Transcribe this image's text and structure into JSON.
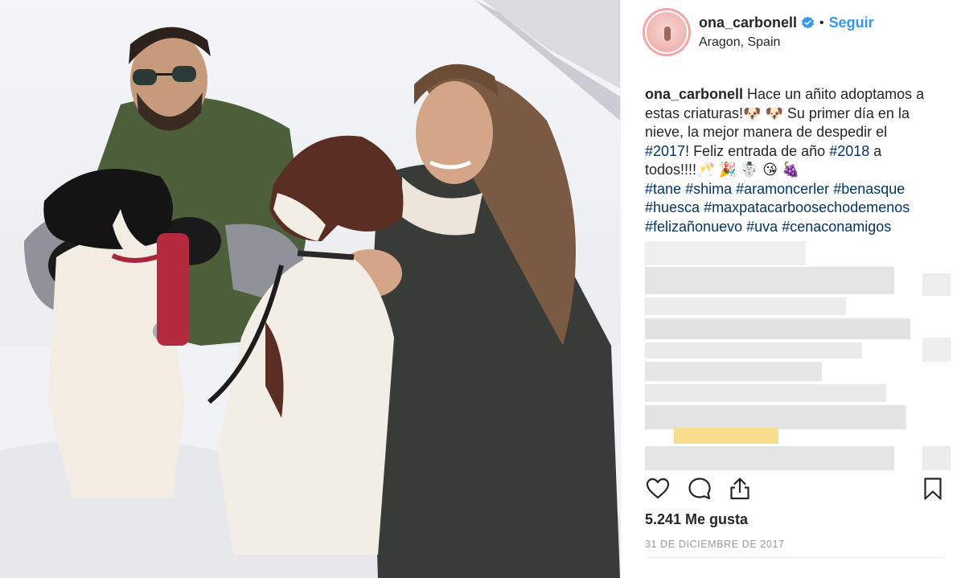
{
  "post": {
    "username": "ona_carbonell",
    "location": "Aragon, Spain",
    "follow_label": "Seguir",
    "separator": "•",
    "caption": {
      "user": "ona_carbonell",
      "line1": "Hace un añito adoptamos a",
      "line2": "estas criaturas!🐶 🐶  Su primer día en la",
      "line3": "nieve, la mejor manera de despedir el",
      "tag_2017": "#2017",
      "line4_mid": "! Feliz entrada de año ",
      "tag_2018": "#2018",
      "line4_end": " a",
      "line5": "todos!!!!🥂 🎉 ☃️ 😘 🍇",
      "tags_row1": [
        "#tane",
        "#shima",
        "#aramoncerler",
        "#benasque"
      ],
      "tags_row2": [
        "#huesca",
        "#maxpatacarboosechodemenos"
      ],
      "tags_row3": [
        "#felizañonuevo",
        "#uva",
        "#cenaconamigos"
      ]
    },
    "likes": "5.241 Me gusta",
    "date": "31 DE DICIEMBRE DE 2017"
  },
  "colors": {
    "link_blue": "#3897f0",
    "hashtag_blue": "#003569",
    "muted_text": "#999999",
    "avatar_ring": "#f4a6a6"
  },
  "icons": {
    "verified": "verified-badge-icon",
    "like": "heart-icon",
    "comment": "comment-bubble-icon",
    "share": "share-upload-icon",
    "save": "bookmark-icon"
  }
}
